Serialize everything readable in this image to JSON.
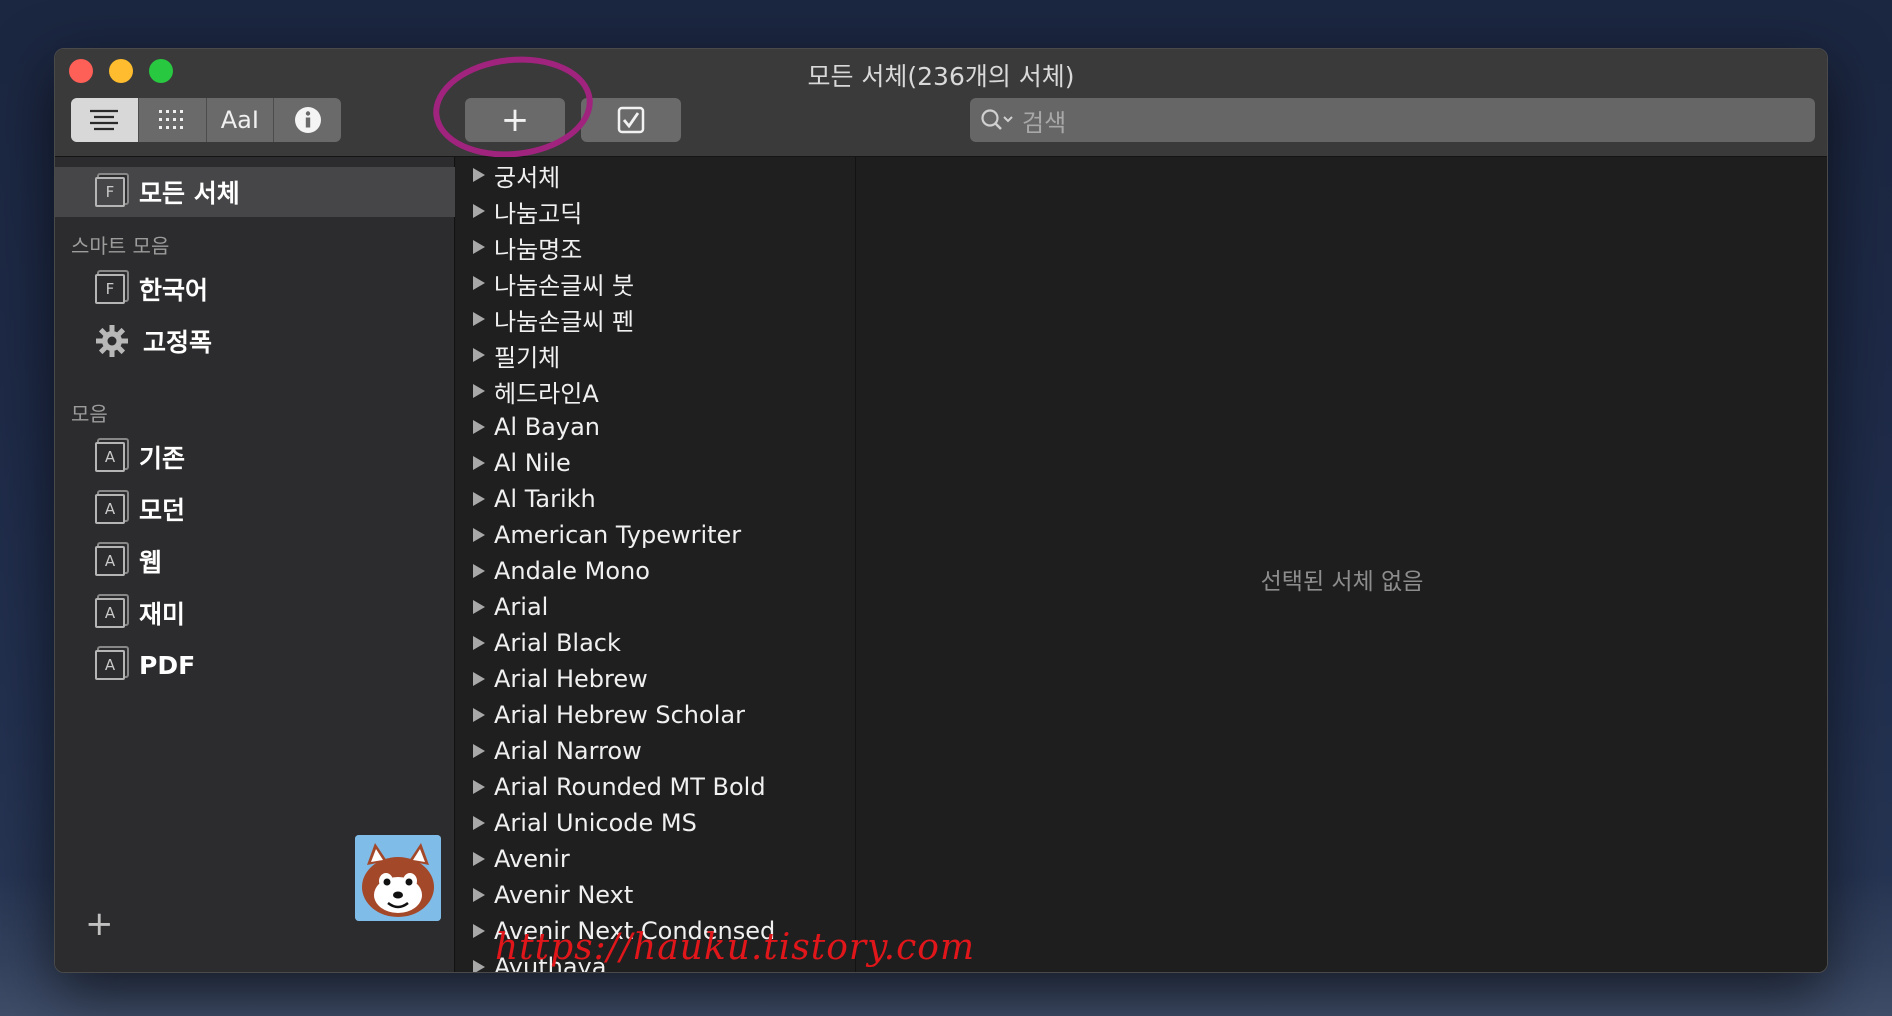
{
  "window": {
    "title": "모든 서체(236개의 서체)"
  },
  "toolbar": {
    "view_modes": [
      {
        "name": "list-view-icon"
      },
      {
        "name": "grid-view-icon"
      },
      {
        "name": "sample-view",
        "label": "AaI"
      },
      {
        "name": "info-icon"
      }
    ],
    "add_label": "+",
    "search_placeholder": "검색"
  },
  "sidebar": {
    "all_fonts": "모든 서체",
    "smart_heading": "스마트 모음",
    "smart_items": [
      {
        "label": "한국어",
        "icon": "font-collection-icon"
      },
      {
        "label": "고정폭",
        "icon": "gear-icon"
      }
    ],
    "collections_heading": "모음",
    "collections": [
      {
        "label": "기존"
      },
      {
        "label": "모던"
      },
      {
        "label": "웹"
      },
      {
        "label": "재미"
      },
      {
        "label": "PDF"
      }
    ],
    "add_label": "+"
  },
  "font_list": [
    "궁서체",
    "나눔고딕",
    "나눔명조",
    "나눔손글씨 붓",
    "나눔손글씨 펜",
    "필기체",
    "헤드라인A",
    "Al Bayan",
    "Al Nile",
    "Al Tarikh",
    "American Typewriter",
    "Andale Mono",
    "Arial",
    "Arial Black",
    "Arial Hebrew",
    "Arial Hebrew Scholar",
    "Arial Narrow",
    "Arial Rounded MT Bold",
    "Arial Unicode MS",
    "Avenir",
    "Avenir Next",
    "Avenir Next Condensed",
    "Ayuthaya"
  ],
  "preview": {
    "empty_text": "선택된 서체 없음"
  },
  "watermark": "https://hauku.tistory.com",
  "colors": {
    "highlight_ring": "#a0237e",
    "watermark": "#e0161a"
  }
}
